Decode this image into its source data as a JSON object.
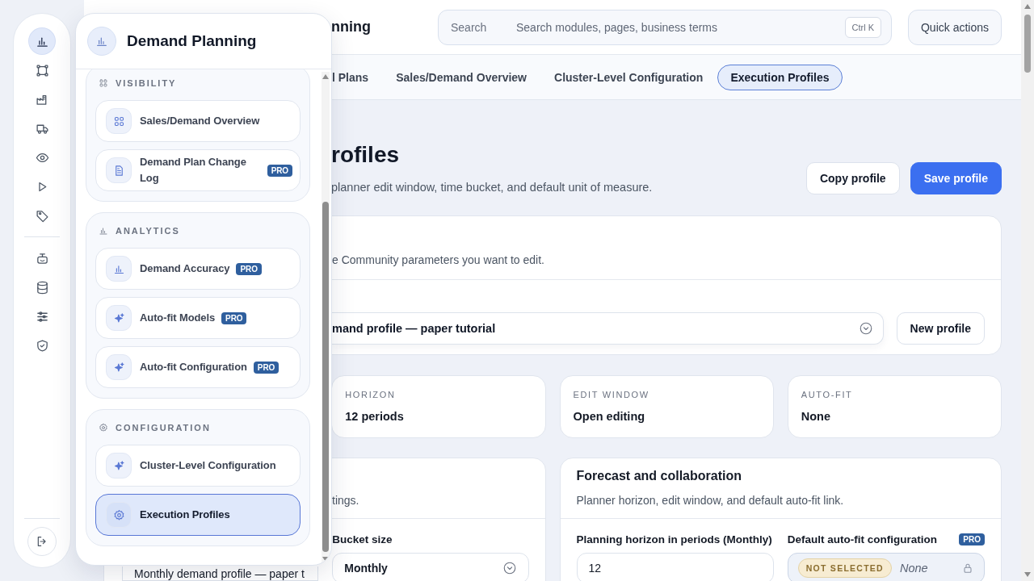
{
  "rail": {
    "items": [
      {
        "selected": true
      },
      {
        "selected": false
      },
      {
        "selected": false
      },
      {
        "selected": false
      },
      {
        "selected": false
      },
      {
        "selected": false
      },
      {
        "selected": false
      },
      {
        "selected": false
      },
      {
        "selected": false
      },
      {
        "selected": false
      },
      {
        "selected": false
      }
    ]
  },
  "flyout": {
    "title": "Demand Planning",
    "groups": [
      {
        "label": "VISIBILITY",
        "items": [
          {
            "label": "Sales/Demand Overview",
            "selected": false
          },
          {
            "label": "Demand Plan Change Log",
            "badge": "PRO",
            "selected": false
          }
        ]
      },
      {
        "label": "ANALYTICS",
        "items": [
          {
            "label": "Demand Accuracy",
            "badge": "PRO",
            "selected": false
          },
          {
            "label": "Auto-fit Models",
            "badge": "PRO",
            "selected": false
          },
          {
            "label": "Auto-fit Configuration",
            "badge": "PRO",
            "selected": false
          }
        ]
      },
      {
        "label": "CONFIGURATION",
        "items": [
          {
            "label": "Cluster-Level Configuration",
            "selected": false
          },
          {
            "label": "Execution Profiles",
            "selected": true
          }
        ]
      }
    ]
  },
  "header": {
    "title": "nning",
    "search": {
      "label": "Search",
      "placeholder": "Search modules, pages, business terms",
      "shortcut": "Ctrl K"
    },
    "quick_actions": "Quick actions"
  },
  "tabs": [
    {
      "label": "l Plans",
      "selected": false
    },
    {
      "label": "Sales/Demand Overview",
      "selected": false
    },
    {
      "label": "Cluster-Level Configuration",
      "selected": false
    },
    {
      "label": "Execution Profiles",
      "selected": true
    }
  ],
  "page": {
    "title": "rofiles",
    "subtitle": "planner edit window, time bucket, and default unit of measure.",
    "actions": [
      {
        "label": "Copy profile",
        "kind": "secondary"
      },
      {
        "label": "Save profile",
        "kind": "primary"
      }
    ]
  },
  "profile_card": {
    "description": "e Community parameters you want to edit.",
    "select_value": "mand profile — paper tutorial",
    "button": "New profile"
  },
  "stats": [
    {
      "label": "HORIZON",
      "value": "12 periods"
    },
    {
      "label": "EDIT WINDOW",
      "value": "Open editing"
    },
    {
      "label": "AUTO-FIT",
      "value": "None"
    }
  ],
  "panels": [
    {
      "description": "tings.",
      "fields": [
        {
          "kind": "text",
          "value": "Monthly demand profile — paper t"
        },
        {
          "kind": "select",
          "label": "Bucket size",
          "value": "Monthly"
        }
      ]
    },
    {
      "title": "Forecast and collaboration",
      "description": "Planner horizon, edit window, and default auto-fit link.",
      "fields": [
        {
          "kind": "text",
          "label": "Planning horizon in periods (Monthly)",
          "value": "12"
        },
        {
          "kind": "locked",
          "label": "Default auto-fit configuration",
          "badge": "PRO",
          "status": "NOT SELECTED",
          "value": "None"
        }
      ]
    }
  ]
}
